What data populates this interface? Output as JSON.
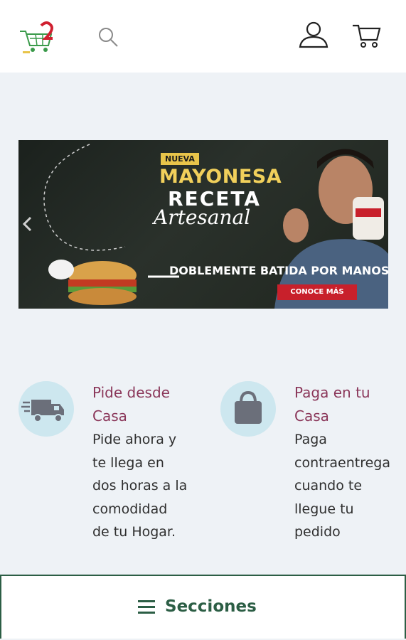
{
  "header": {
    "logo_icon": "shopping-cart-logo",
    "search_icon": "search-icon",
    "account_icon": "user-icon",
    "cart_icon": "cart-icon"
  },
  "banner": {
    "badge": "NUEVA",
    "title_line1": "MAYONESA",
    "title_line2": "RECETA",
    "title_line3": "Artesanal",
    "tagline": "DOBLEMENTE BATIDA POR MANOS",
    "cta_label": "CONOCE MÁS",
    "prev_icon": "chevron-left-icon"
  },
  "features": [
    {
      "icon": "delivery-truck-icon",
      "title": "Pide desde Casa",
      "lines": [
        "Pide ahora y",
        "te llega en",
        "dos horas a la",
        "comodidad",
        "de tu Hogar."
      ]
    },
    {
      "icon": "shopping-bag-icon",
      "title": "Paga en tu Casa",
      "lines": [
        "Paga",
        "contraentrega",
        "cuando te",
        "llegue tu",
        "pedido"
      ]
    }
  ],
  "bottom_bar": {
    "icon": "menu-icon",
    "label": "Secciones"
  },
  "colors": {
    "accent_green": "#2c5e45",
    "feature_title": "#8a3659",
    "icon_circle": "#cde7ef",
    "cta_red": "#c8202b"
  }
}
